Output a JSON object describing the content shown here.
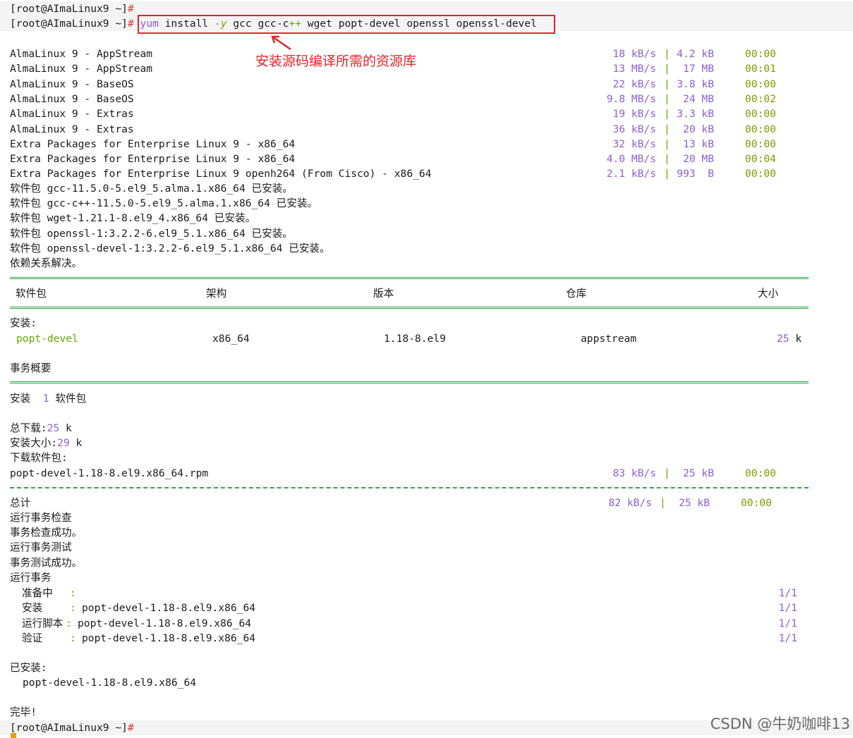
{
  "prompts": {
    "p1": "[root@AImaLinux9 ~]",
    "p2": "[root@AImaLinux9 ~]",
    "p3": "[root@AImaLinux9 ~]",
    "hash": "#"
  },
  "command": {
    "cmd": "yum",
    "t1": " install ",
    "flag": "-y",
    "t2": " gcc gcc-c",
    "pp": "++",
    "t3": " wget popt-devel openssl openssl-devel"
  },
  "annotation": "安装源码编译所需的资源库",
  "repos": [
    {
      "name": "AlmaLinux 9 - AppStream",
      "speed": "18 kB/s",
      "size": "4.2 kB",
      "time": "00:00"
    },
    {
      "name": "AlmaLinux 9 - AppStream",
      "speed": "13 MB/s",
      "size": "17 MB",
      "time": "00:01"
    },
    {
      "name": "AlmaLinux 9 - BaseOS",
      "speed": "22 kB/s",
      "size": "3.8 kB",
      "time": "00:00"
    },
    {
      "name": "AlmaLinux 9 - BaseOS",
      "speed": "9.8 MB/s",
      "size": "24 MB",
      "time": "00:02"
    },
    {
      "name": "AlmaLinux 9 - Extras",
      "speed": "19 kB/s",
      "size": "3.3 kB",
      "time": "00:00"
    },
    {
      "name": "AlmaLinux 9 - Extras",
      "speed": "36 kB/s",
      "size": "20 kB",
      "time": "00:00"
    },
    {
      "name": "Extra Packages for Enterprise Linux 9 - x86_64",
      "speed": "32 kB/s",
      "size": "13 kB",
      "time": "00:00"
    },
    {
      "name": "Extra Packages for Enterprise Linux 9 - x86_64",
      "speed": "4.0 MB/s",
      "size": "20 MB",
      "time": "00:04"
    },
    {
      "name": "Extra Packages for Enterprise Linux 9 openh264 (From Cisco) - x86_64",
      "speed": "2.1 kB/s",
      "size": "993  B",
      "time": "00:00"
    }
  ],
  "installed_msgs": [
    "软件包 gcc-11.5.0-5.el9_5.alma.1.x86_64 已安装。",
    "软件包 gcc-c++-11.5.0-5.el9_5.alma.1.x86_64 已安装。",
    "软件包 wget-1.21.1-8.el9_4.x86_64 已安装。",
    "软件包 openssl-1:3.2.2-6.el9_5.1.x86_64 已安装。",
    "软件包 openssl-devel-1:3.2.2-6.el9_5.1.x86_64 已安装。",
    "依赖关系解决。"
  ],
  "table": {
    "headers": [
      "软件包",
      "架构",
      "版本",
      "仓库",
      "大小"
    ],
    "section": "安装:",
    "row": {
      "pkg": "popt-devel",
      "arch": "x86_64",
      "ver": "1.18-8.el9",
      "repo": "appstream",
      "size_num": "25",
      "size_unit": "k"
    }
  },
  "summary": {
    "title": "事务概要",
    "install_label": "安装",
    "install_count": "1",
    "install_unit": "软件包",
    "total_dl_label": "总下载:",
    "total_dl_num": "25",
    "total_dl_unit": "k",
    "inst_size_label": "安装大小:",
    "inst_size_num": "29",
    "inst_size_unit": "k",
    "dl_pkgs_label": "下载软件包:"
  },
  "download": {
    "file": "popt-devel-1.18-8.el9.x86_64.rpm",
    "speed": "83 kB/s",
    "size": "25 kB",
    "time": "00:00"
  },
  "total": {
    "label": "总计",
    "speed": "82 kB/s",
    "size": "25 kB",
    "time": "00:00"
  },
  "run_msgs": [
    "运行事务检查",
    "事务检查成功。",
    "运行事务测试",
    "事务测试成功。",
    "运行事务"
  ],
  "steps": [
    {
      "label": "准备中",
      "pkg": "",
      "progress": "1/1"
    },
    {
      "label": "安装",
      "pkg": "popt-devel-1.18-8.el9.x86_64",
      "progress": "1/1"
    },
    {
      "label": "运行脚本",
      "pkg": "popt-devel-1.18-8.el9.x86_64",
      "progress": "1/1"
    },
    {
      "label": "验证",
      "pkg": "popt-devel-1.18-8.el9.x86_64",
      "progress": "1/1"
    }
  ],
  "installed_label": "已安装:",
  "installed_pkg": "popt-devel-1.18-8.el9.x86_64",
  "done": "完毕!",
  "watermark": "CSDN @牛奶咖啡13"
}
